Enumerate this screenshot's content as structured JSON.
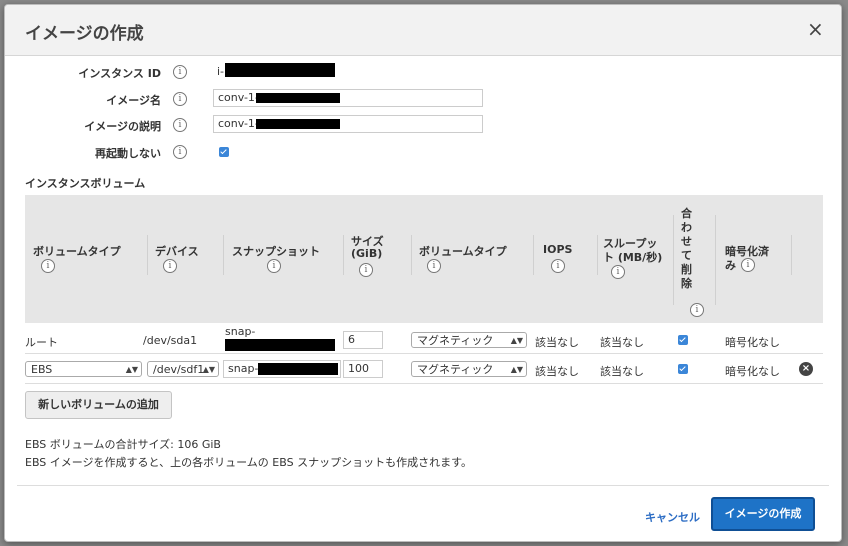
{
  "modal": {
    "title": "イメージの作成",
    "close_label": "×"
  },
  "form": {
    "instance_id_label": "インスタンス ID",
    "instance_id_value": "i-",
    "image_name_label": "イメージ名",
    "image_name_value": "conv-1-",
    "image_desc_label": "イメージの説明",
    "image_desc_value": "conv-1-",
    "no_reboot_label": "再起動しない",
    "no_reboot_checked": true
  },
  "volumes": {
    "section_title": "インスタンスボリューム",
    "columns": {
      "volume_type": "ボリュームタイプ",
      "device": "デバイス",
      "snapshot": "スナップショット",
      "size_line1": "サイズ",
      "size_line2": "(GiB)",
      "vol_type2": "ボリュームタイプ",
      "iops": "IOPS",
      "throughput_line1": "スループッ",
      "throughput_line2": "ト (MB/秒)",
      "delete_chars": [
        "合",
        "わ",
        "せ",
        "て",
        "削",
        "除"
      ],
      "encrypted_line1": "暗号化済",
      "encrypted_line2": "み"
    },
    "rows": [
      {
        "type": "ルート",
        "device": "/dev/sda1",
        "snapshot": "snap-",
        "size": "6",
        "volume_type": "マグネティック",
        "iops": "該当なし",
        "throughput": "該当なし",
        "delete_on_termination": true,
        "encrypted": "暗号化なし"
      },
      {
        "type": "EBS",
        "device": "/dev/sdf1",
        "snapshot": "snap-",
        "size": "100",
        "volume_type": "マグネティック",
        "iops": "該当なし",
        "throughput": "該当なし",
        "delete_on_termination": true,
        "encrypted": "暗号化なし"
      }
    ],
    "add_button": "新しいボリュームの追加"
  },
  "footer": {
    "total_size": "EBS ボリュームの合計サイズ: 106 GiB",
    "note": "EBS イメージを作成すると、上の各ボリュームの EBS スナップショットも作成されます。",
    "cancel": "キャンセル",
    "create": "イメージの作成"
  },
  "colors": {
    "primary": "#1e73c7",
    "link": "#2b6cc4",
    "header_bg": "#f2f2f2"
  }
}
